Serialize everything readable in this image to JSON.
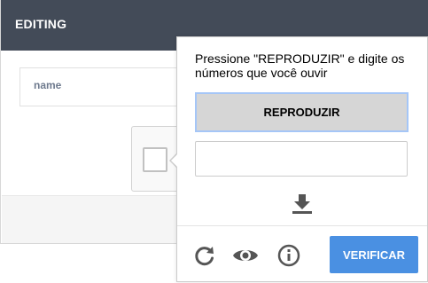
{
  "header": {
    "title": "EDITING"
  },
  "form": {
    "name_label": "name"
  },
  "challenge": {
    "instructions": "Pressione \"REPRODUZIR\" e digite os números que você ouvir",
    "play_label": "REPRODUZIR",
    "answer_value": "",
    "download_icon": "download-icon",
    "reload_icon": "reload-icon",
    "audio_icon": "eye-icon",
    "info_icon": "info-icon",
    "verify_label": "VERIFICAR"
  },
  "colors": {
    "header_bg": "#434b58",
    "verify_bg": "#4a90e2",
    "icon_gray": "#555555"
  }
}
